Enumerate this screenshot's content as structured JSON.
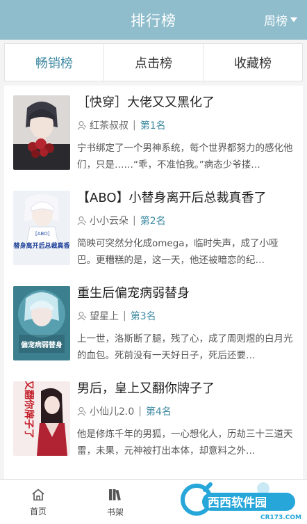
{
  "header": {
    "title": "排行榜",
    "period": "周榜"
  },
  "tabs": [
    {
      "label": "畅销榜",
      "active": true
    },
    {
      "label": "点击榜",
      "active": false
    },
    {
      "label": "收藏榜",
      "active": false
    }
  ],
  "books": [
    {
      "title": "［快穿］大佬又又黑化了",
      "author": "红茶叔叔",
      "rank": "第1名",
      "description": "宁书绑定了一个男神系统，每个世界都努力的感化他们，只是……“乖，不准怕我。”病态少爷搂…"
    },
    {
      "title": "【ABO】小替身离开后总裁真香了",
      "author": "小小云朵",
      "rank": "第2名",
      "description": "简映可突然分化成omega，临时失声，成了小哑巴。更糟糕的是，这一天，他还被暗恋的纪…",
      "cover_text": "小替身离开后总裁真香了",
      "cover_tag": "[ABO]"
    },
    {
      "title": "重生后偏宠病弱替身",
      "author": "望星上",
      "rank": "第3名",
      "description": "上一世，洛斯断了腿，残了心，成了周则煜的白月光的血包。死前没有一天好日子，死后还要…",
      "cover_text": "偏宠病弱替身"
    },
    {
      "title": "男后，皇上又翻你牌子了",
      "author": "小仙儿2.0",
      "rank": "第4名",
      "description": "他是修炼千年的男狐，一心想化人，历劫三十三道天雷，未果，元神被打出本体，却意料之外…",
      "cover_text": "又翻你牌子了"
    }
  ],
  "nav": [
    {
      "label": "首页"
    },
    {
      "label": "书架"
    }
  ],
  "watermark": {
    "text": "西西软件园",
    "url": "CR173.COM"
  },
  "colors": {
    "header": "#8fbdcc",
    "accent": "#3e8aa2"
  }
}
